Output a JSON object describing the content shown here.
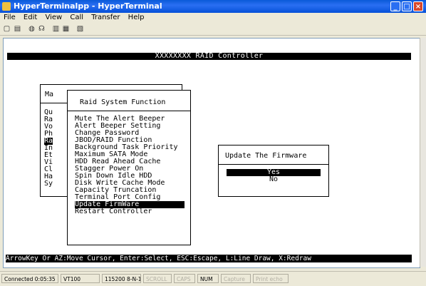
{
  "window": {
    "title": "HyperTerminalpp - HyperTerminal"
  },
  "menu": [
    "File",
    "Edit",
    "View",
    "Call",
    "Transfer",
    "Help"
  ],
  "terminal": {
    "header": "XXXXXXXX RAID Controller",
    "footer": "ArrowKey Or AZ:Move Cursor, Enter:Select, ESC:Escape, L:Line Draw, X:Redraw",
    "main_menu": {
      "title": "Ma",
      "items": [
        "Qu",
        "Ra",
        "Vo",
        "Ph",
        "Ra",
        "In",
        "Et",
        "Vi",
        "Cl",
        "Ha",
        "Sy"
      ],
      "selected_index": 4
    },
    "raid_menu": {
      "title": "Raid System Function",
      "items": [
        "Mute The Alert Beeper",
        "Alert Beeper Setting",
        "Change Password",
        "JBOD/RAID Function",
        "Background Task Priority",
        "Maximum SATA Mode",
        "HDD Read Ahead Cache",
        "Stagger Power On",
        "Spin Down Idle HDD",
        "Disk Write Cache Mode",
        "Capacity Truncation",
        "Terminal Port Config",
        "Update FirmWare",
        "Restart Controller"
      ],
      "selected_index": 12
    },
    "dialog": {
      "title": "Update The Firmware",
      "options": [
        "Yes",
        "No"
      ],
      "selected_index": 0
    }
  },
  "status": {
    "connected": "Connected 0:05:35",
    "emulation": "VT100",
    "settings": "115200 8-N-1",
    "scroll": "SCROLL",
    "caps": "CAPS",
    "num": "NUM",
    "capture": "Capture",
    "print": "Print echo"
  }
}
